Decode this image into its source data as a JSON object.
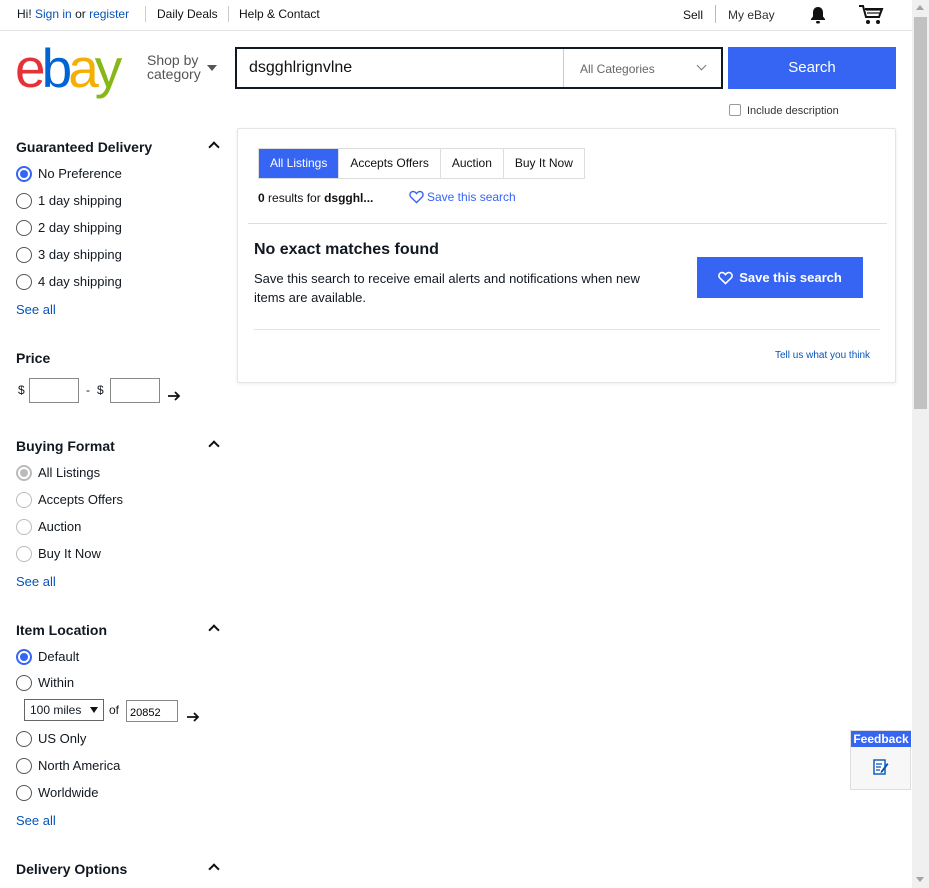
{
  "topbar": {
    "greeting": "Hi!",
    "sign_in": "Sign in",
    "or": "or",
    "register": "register",
    "daily_deals": "Daily Deals",
    "help_contact": "Help & Contact",
    "sell": "Sell",
    "my_ebay": "My eBay"
  },
  "header": {
    "logo_letters": [
      "e",
      "b",
      "a",
      "y"
    ],
    "logo_colors": [
      "#e53238",
      "#0064d2",
      "#f5af02",
      "#86b817"
    ],
    "shop_by_line1": "Shop by",
    "shop_by_line2": "category",
    "search_value": "dsgghlrignvlne",
    "category_select": "All Categories",
    "search_button": "Search",
    "include_description": "Include description"
  },
  "sidebar": {
    "guaranteed_delivery": {
      "title": "Guaranteed Delivery",
      "options": [
        "No Preference",
        "1 day shipping",
        "2 day shipping",
        "3 day shipping",
        "4 day shipping"
      ],
      "selected": "No Preference",
      "see_all": "See all"
    },
    "price": {
      "title": "Price",
      "currency": "$",
      "dash": "-",
      "currency2": "$"
    },
    "buying_format": {
      "title": "Buying Format",
      "options": [
        "All Listings",
        "Accepts Offers",
        "Auction",
        "Buy It Now"
      ],
      "selected": "All Listings",
      "see_all": "See all"
    },
    "item_location": {
      "title": "Item Location",
      "options": [
        "Default",
        "Within",
        "US Only",
        "North America",
        "Worldwide"
      ],
      "selected": "Default",
      "miles": "100 miles",
      "of": "of",
      "zip": "20852",
      "see_all": "See all"
    },
    "delivery_options": {
      "title": "Delivery Options"
    }
  },
  "results": {
    "tabs": [
      "All Listings",
      "Accepts Offers",
      "Auction",
      "Buy It Now"
    ],
    "active_tab": "All Listings",
    "count": "0",
    "results_for": "results for",
    "query_truncated": "dsgghl...",
    "save_search_link": "Save this search",
    "no_match_title": "No exact matches found",
    "no_match_desc": "Save this search to receive email alerts and notifications when new items are available.",
    "save_search_button": "Save this search",
    "tell_us": "Tell us what you think"
  },
  "feedback": {
    "label": "Feedback"
  },
  "colors": {
    "accent": "#3665f3",
    "link": "#0654ba"
  }
}
